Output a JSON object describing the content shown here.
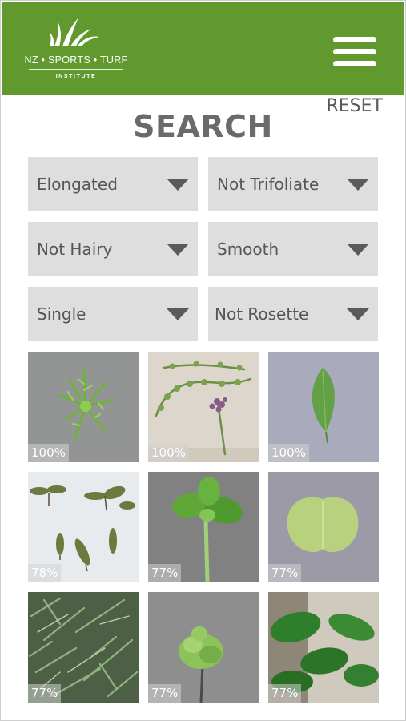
{
  "header": {
    "logo_brand": "NZ • SPORTS • TURF",
    "logo_sub": "INSTITUTE",
    "menu_icon": "hamburger-menu-icon",
    "color": "#62992f"
  },
  "reset_label": "RESET",
  "title": "SEARCH",
  "filters": [
    {
      "label": "Elongated"
    },
    {
      "label": "Not Trifoliate"
    },
    {
      "label": "Not Hairy"
    },
    {
      "label": "Smooth"
    },
    {
      "label": "Single"
    },
    {
      "label": "Not Rosette"
    }
  ],
  "results": [
    {
      "match": "100%"
    },
    {
      "match": "100%"
    },
    {
      "match": "100%"
    },
    {
      "match": "78%"
    },
    {
      "match": "77%"
    },
    {
      "match": "77%"
    },
    {
      "match": "77%"
    },
    {
      "match": "77%"
    },
    {
      "match": "77%"
    }
  ]
}
